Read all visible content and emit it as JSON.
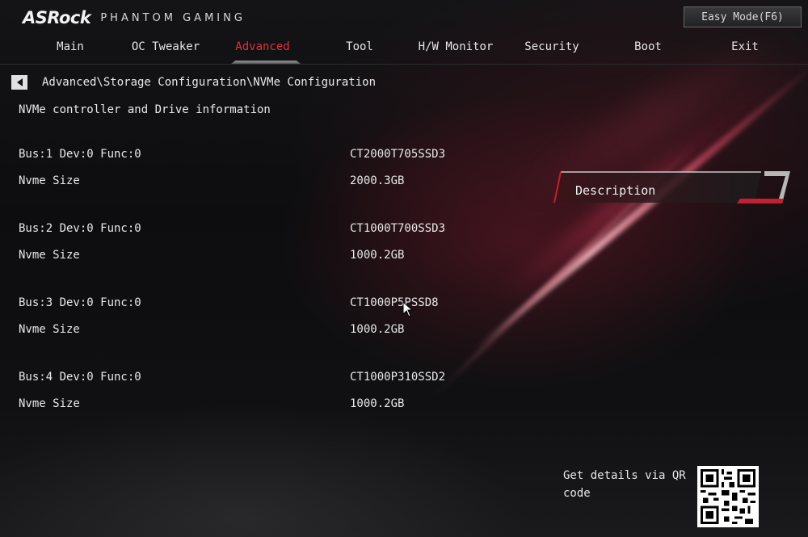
{
  "header": {
    "brand": "ASRock",
    "brand_sub": "PHANTOM GAMING",
    "easy_mode_label": "Easy Mode(F6)"
  },
  "menu": [
    {
      "label": "Main",
      "active": false
    },
    {
      "label": "OC Tweaker",
      "active": false
    },
    {
      "label": "Advanced",
      "active": true
    },
    {
      "label": "Tool",
      "active": false
    },
    {
      "label": "H/W Monitor",
      "active": false
    },
    {
      "label": "Security",
      "active": false
    },
    {
      "label": "Boot",
      "active": false
    },
    {
      "label": "Exit",
      "active": false
    }
  ],
  "breadcrumb": "Advanced\\Storage Configuration\\NVMe Configuration",
  "section_title": "NVMe controller and Drive information",
  "drives": [
    {
      "bus_label": "Bus:1 Dev:0 Func:0",
      "model": "CT2000T705SSD3",
      "size_label": "Nvme Size",
      "size": "2000.3GB"
    },
    {
      "bus_label": "Bus:2 Dev:0 Func:0",
      "model": "CT1000T700SSD3",
      "size_label": "Nvme Size",
      "size": "1000.2GB"
    },
    {
      "bus_label": "Bus:3 Dev:0 Func:0",
      "model": "CT1000P5PSSD8",
      "size_label": "Nvme Size",
      "size": "1000.2GB"
    },
    {
      "bus_label": "Bus:4 Dev:0 Func:0",
      "model": "CT1000P310SSD2",
      "size_label": "Nvme Size",
      "size": "1000.2GB"
    }
  ],
  "description_label": "Description",
  "qr_text": "Get details via QR code",
  "colors": {
    "accent": "#e0303c",
    "text": "#e8e8e8",
    "background": "#0c0c0e"
  }
}
